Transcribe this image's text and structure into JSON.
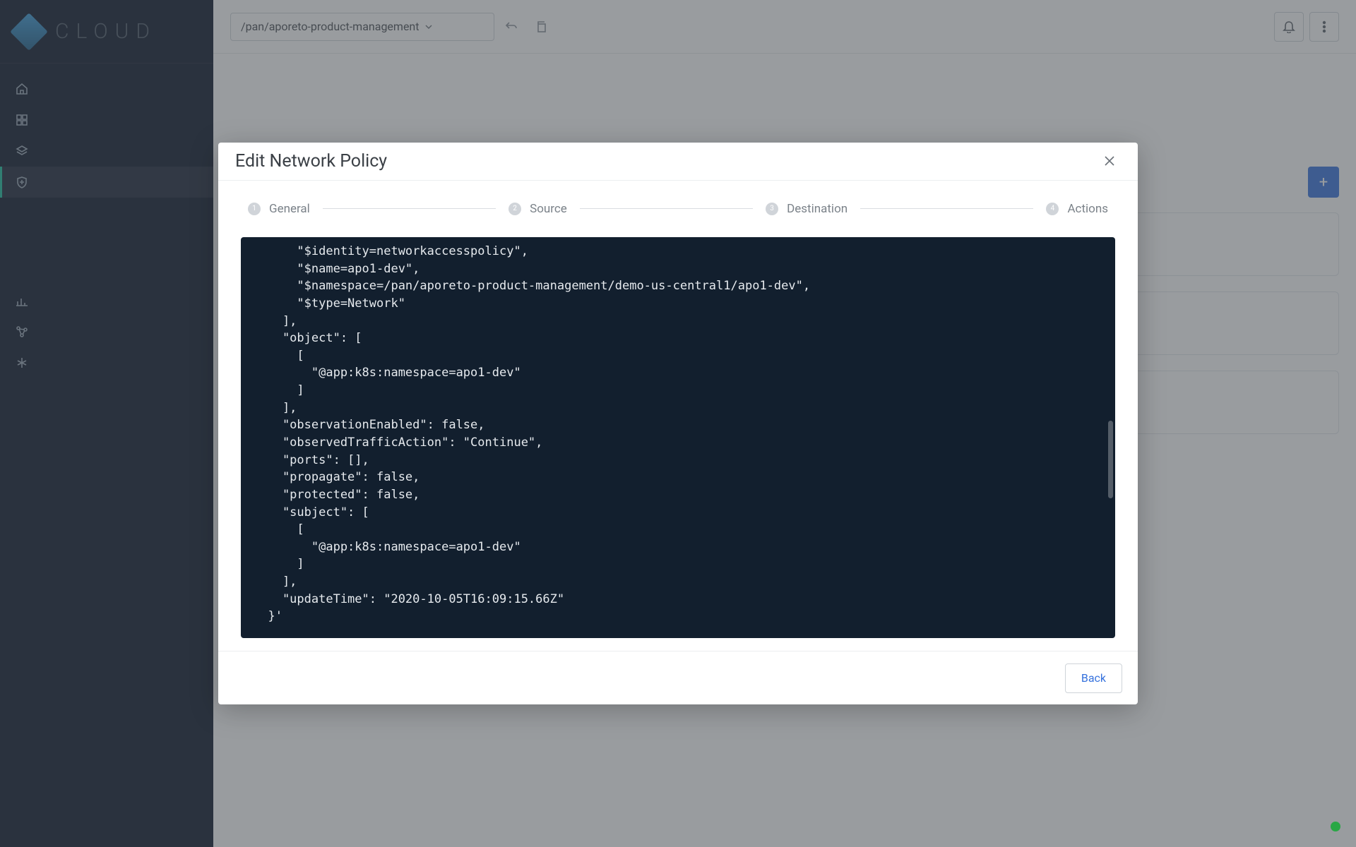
{
  "logo": {
    "text": "CLOUD"
  },
  "breadcrumb": {
    "path": "/pan/aporeto-product-management"
  },
  "modal": {
    "title": "Edit Network Policy",
    "stepper": [
      {
        "num": "1",
        "label": "General"
      },
      {
        "num": "2",
        "label": "Source"
      },
      {
        "num": "3",
        "label": "Destination"
      },
      {
        "num": "4",
        "label": "Actions"
      }
    ],
    "code": "      \"$identity=networkaccesspolicy\",\n      \"$name=apo1-dev\",\n      \"$namespace=/pan/aporeto-product-management/demo-us-central1/apo1-dev\",\n      \"$type=Network\"\n    ],\n    \"object\": [\n      [\n        \"@app:k8s:namespace=apo1-dev\"\n      ]\n    ],\n    \"observationEnabled\": false,\n    \"observedTrafficAction\": \"Continue\",\n    \"ports\": [],\n    \"propagate\": false,\n    \"protected\": false,\n    \"subject\": [\n      [\n        \"@app:k8s:namespace=apo1-dev\"\n      ]\n    ],\n    \"updateTime\": \"2020-10-05T16:09:15.66Z\"\n  }'",
    "back_label": "Back"
  }
}
